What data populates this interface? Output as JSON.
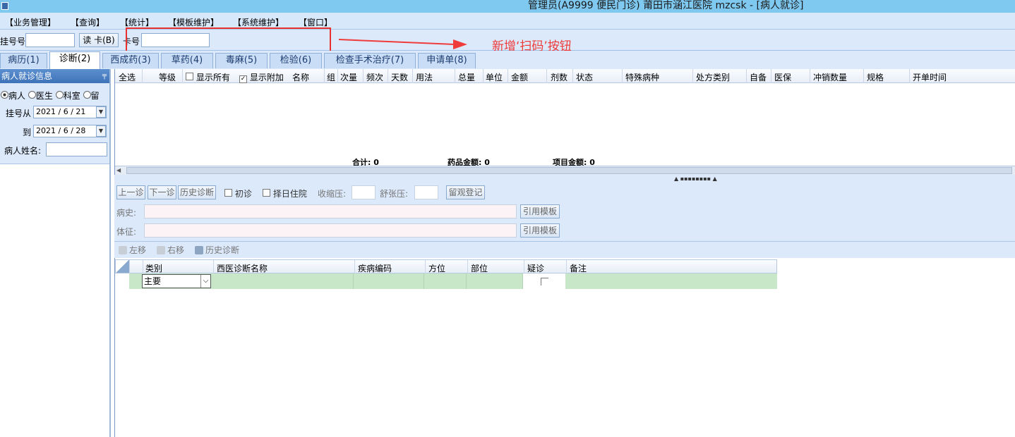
{
  "window": {
    "title": "管理员(A9999 便民门诊) 莆田市涵江医院 mzcsk - [病人就诊]"
  },
  "menu": [
    "【业务管理】",
    "【查询】",
    "【统计】",
    "【模板维护】",
    "【系统维护】",
    "【窗口】"
  ],
  "toolbar": {
    "reg_label": "挂号号",
    "reg_value": "",
    "read_card_label": "读 卡(B)",
    "card_label": "卡号",
    "card_value": ""
  },
  "annotation": {
    "text": "新增‘扫码’按钮",
    "color": "#ef3b3a"
  },
  "tabs": [
    {
      "label": "病历(1)",
      "active": false
    },
    {
      "label": "诊断(2)",
      "active": true
    },
    {
      "label": "西成药(3)",
      "active": false
    },
    {
      "label": "草药(4)",
      "active": false
    },
    {
      "label": "毒麻(5)",
      "active": false
    },
    {
      "label": "检验(6)",
      "active": false
    },
    {
      "label": "检查手术治疗(7)",
      "active": false
    },
    {
      "label": "申请单(8)",
      "active": false
    }
  ],
  "left_panel": {
    "header": "病人就诊信息",
    "pin_icon": "pin-icon",
    "radios": [
      "病人",
      "医生",
      "科室",
      "留"
    ],
    "reg_from_label": "挂号从",
    "reg_from_value": "2021 / 6 / 21",
    "to_label": "到",
    "to_value": "2021 / 6 / 28",
    "name_label": "病人姓名:",
    "name_value": ""
  },
  "order_grid": {
    "columns": [
      "全选",
      "等级",
      "显示所有",
      "显示附加",
      "名称",
      "组",
      "次量",
      "频次",
      "天数",
      "用法",
      "总量",
      "单位",
      "金额",
      "剂数",
      "状态",
      "特殊病种",
      "处方类别",
      "自备",
      "医保",
      "冲销数量",
      "规格",
      "开单时间"
    ],
    "show_all_checked": false,
    "show_extra_checked": true,
    "totals": {
      "total_label": "合计:",
      "total_value": "0",
      "drug_label": "药品金额:",
      "drug_value": "0",
      "item_label": "项目金额:",
      "item_value": "0"
    }
  },
  "diag_form": {
    "prev_label": "上一诊",
    "next_label": "下一诊",
    "history_label": "历史诊断",
    "first_visit_label": "初诊",
    "schedule_label": "择日住院",
    "systolic_label": "收缩压:",
    "diastolic_label": "舒张压:",
    "observe_label": "留观登记",
    "history_field_label": "病史:",
    "exam_field_label": "体征:",
    "template_label": "引用模板"
  },
  "mini_toolbar": {
    "left_label": "左移",
    "right_label": "右移",
    "history_label": "历史诊断"
  },
  "diag_grid": {
    "columns": [
      "类别",
      "西医诊断名称",
      "疾病编码",
      "方位",
      "部位",
      "疑诊",
      "备注"
    ],
    "rows": [
      {
        "category": "主要",
        "checked": false
      }
    ]
  }
}
